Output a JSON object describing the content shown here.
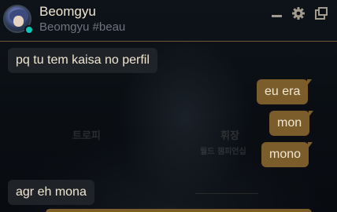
{
  "header": {
    "name": "Beomgyu",
    "riot_id": "Beomgyu #beau",
    "status_color": "#0ac8b9"
  },
  "background_text": {
    "trophy": "트로피",
    "title": "휘장",
    "world": "월드 챔피언십"
  },
  "messages": [
    {
      "text": "pq tu tem kaisa no perfil",
      "direction": "incoming"
    },
    {
      "text": "eu era",
      "direction": "outgoing"
    },
    {
      "text": "mon",
      "direction": "outgoing"
    },
    {
      "text": "mono",
      "direction": "outgoing"
    },
    {
      "text": "agr eh mona",
      "direction": "incoming"
    }
  ],
  "colors": {
    "outgoing_bubble": "#7b5d2c",
    "incoming_bubble": "#1f2328",
    "divider_gold": "#6e5a31"
  },
  "icons": {
    "minimize": "minimize-icon",
    "settings": "gear-icon",
    "popout": "popout-icon"
  }
}
